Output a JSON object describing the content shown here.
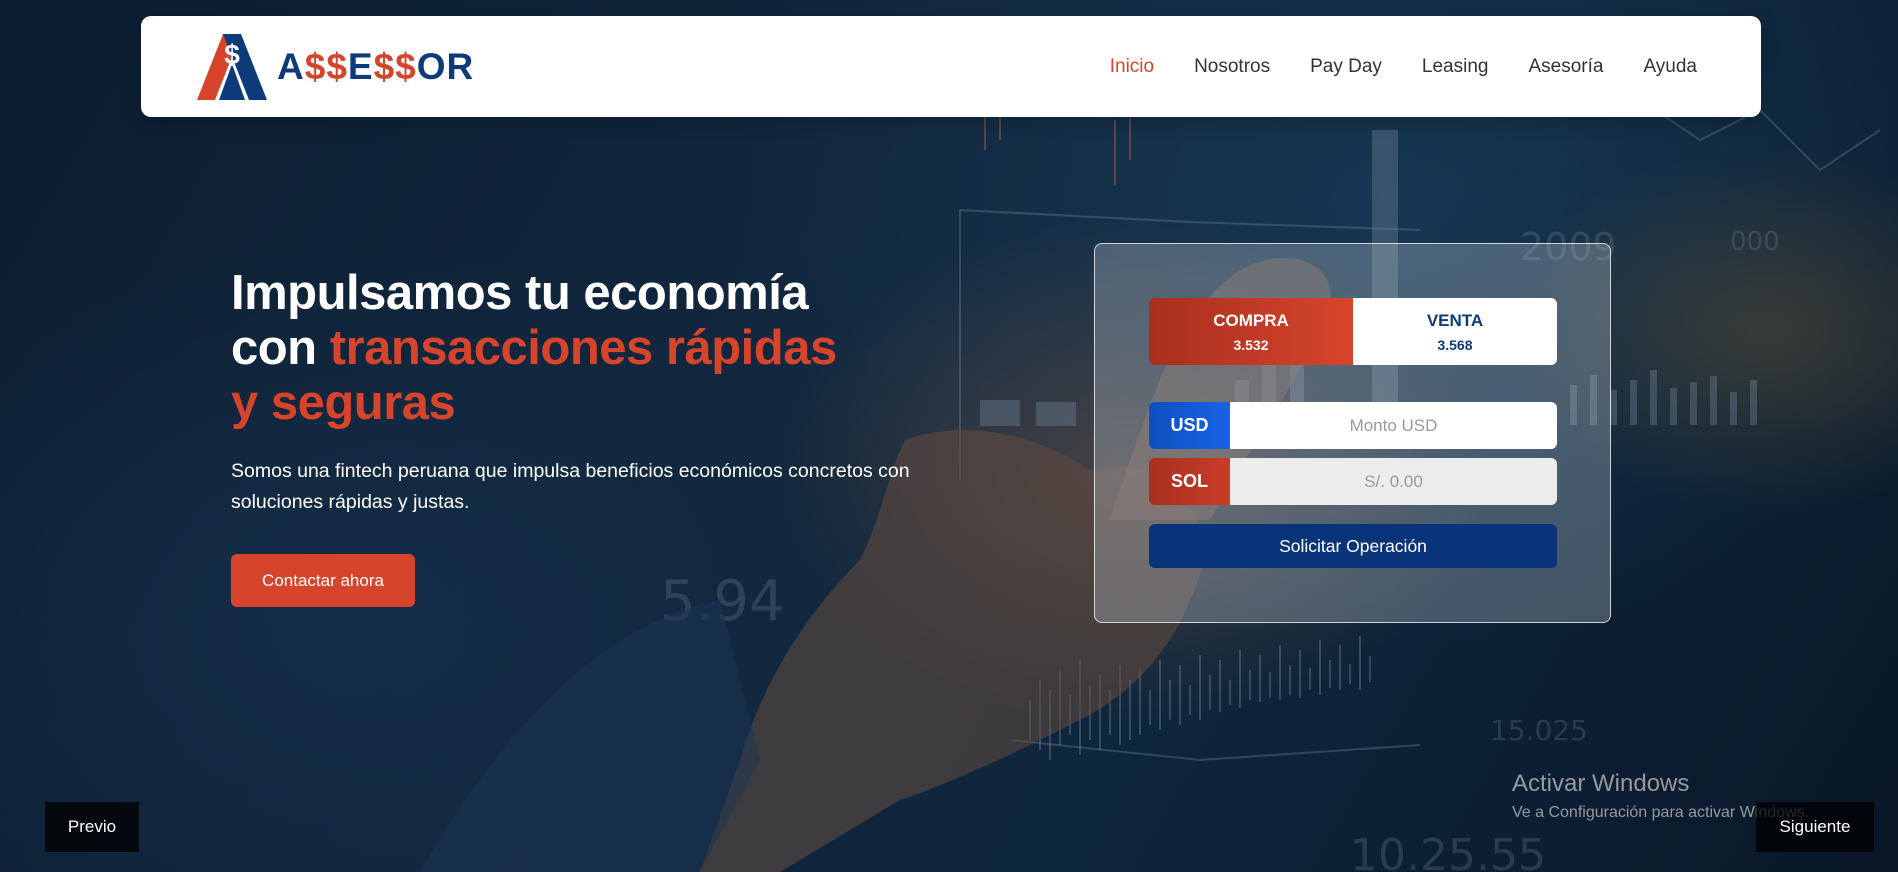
{
  "brand": {
    "name_parts": [
      "A",
      "$",
      "$",
      "E",
      "$",
      "$",
      "OR"
    ],
    "mark_letter": "A",
    "mark_symbol": "$",
    "primary_color": "#0d3b7a",
    "accent_color": "#d6452b"
  },
  "nav": {
    "items": [
      {
        "label": "Inicio",
        "active": true
      },
      {
        "label": "Nosotros",
        "active": false
      },
      {
        "label": "Pay Day",
        "active": false
      },
      {
        "label": "Leasing",
        "active": false
      },
      {
        "label": "Asesoría",
        "active": false
      },
      {
        "label": "Ayuda",
        "active": false
      }
    ]
  },
  "hero": {
    "title_line1": "Impulsamos tu economía",
    "title_line2_prefix": "con ",
    "title_line2_accent": "transacciones rápidas",
    "title_line3_accent": "y seguras",
    "subtitle": "Somos una fintech peruana que impulsa beneficios económicos concretos con soluciones rápidas y justas.",
    "cta_label": "Contactar ahora"
  },
  "exchange": {
    "buy_label": "COMPRA",
    "buy_rate": "3.532",
    "sell_label": "VENTA",
    "sell_rate": "3.568",
    "usd_label": "USD",
    "usd_placeholder": "Monto USD",
    "sol_label": "SOL",
    "sol_placeholder": "S/. 0.00",
    "submit_label": "Solicitar Operación"
  },
  "carousel": {
    "prev_label": "Previo",
    "next_label": "Siguiente"
  },
  "watermark": {
    "title": "Activar Windows",
    "subtitle": "Ve a Configuración para activar Windows."
  }
}
